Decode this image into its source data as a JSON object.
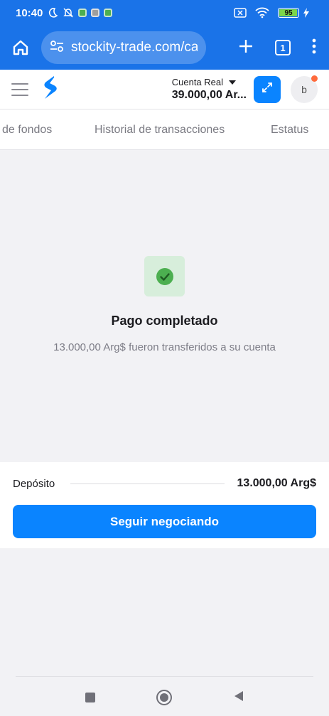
{
  "status_bar": {
    "time": "10:40",
    "battery": "95",
    "battery_level": 0.95
  },
  "browser": {
    "url": "stockity-trade.com/ca",
    "tab_count": "1"
  },
  "header": {
    "account_type": "Cuenta Real",
    "balance": "39.000,00 Ar...",
    "avatar_letter": "b"
  },
  "tabs": [
    "de fondos",
    "Historial de transacciones",
    "Estatus"
  ],
  "success": {
    "title": "Pago completado",
    "message": "13.000,00 Arg$ fueron transferidos a su cuenta"
  },
  "summary": {
    "label": "Depósito",
    "amount": "13.000,00 Arg$",
    "button_label": "Seguir negociando"
  },
  "colors": {
    "browser": "#1a73e8",
    "accent": "#0a84ff",
    "success": "#4caf50",
    "notification": "#ff6b3d"
  },
  "icons": [
    "moon-icon",
    "mute-icon",
    "wifi-icon",
    "battery-icon",
    "home-icon",
    "site-settings-icon",
    "plus-icon",
    "tabs-icon",
    "more-icon",
    "menu-icon",
    "logo-icon",
    "dropdown-icon",
    "swap-icon",
    "check-icon"
  ]
}
